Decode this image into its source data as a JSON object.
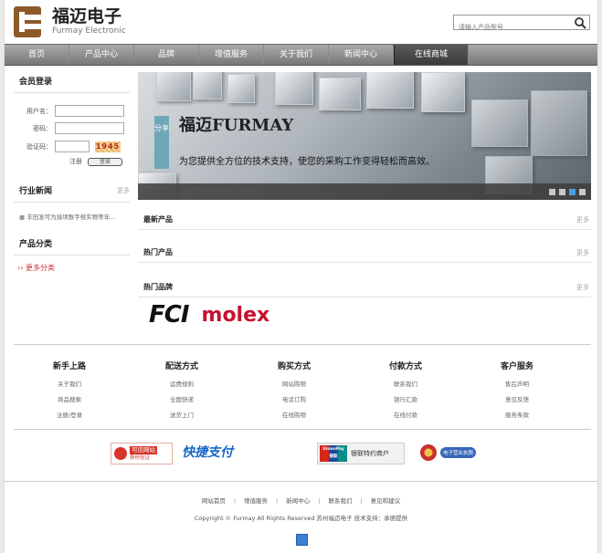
{
  "header": {
    "logo_cn": "福迈电子",
    "logo_en": "Furmay Electronic",
    "search_placeholder": "请输入产品型号"
  },
  "nav": [
    "首页",
    "产品中心",
    "品牌",
    "增值服务",
    "关于我们",
    "新闻中心",
    "在线商城"
  ],
  "sidebar": {
    "login_title": "会员登录",
    "username_label": "用户名：",
    "password_label": "密码：",
    "captcha_label": "验证码：",
    "captcha_code": "1945",
    "register_label": "注册",
    "login_button": "登录",
    "news_title": "行业新闻",
    "news_more": "更多",
    "news_item": "丰田发可为插项数字核实物等年...",
    "category_title": "产品分类",
    "category_more_link": "更多分类"
  },
  "banner": {
    "share": "分享",
    "title": "福迈FURMAY",
    "subtitle": "为您提供全方位的技术支持，使您的采购工作变得轻松而高效。"
  },
  "sections": [
    {
      "title": "最新产品",
      "more": "更多"
    },
    {
      "title": "热门产品",
      "more": "更多"
    },
    {
      "title": "热门品牌",
      "more": "更多"
    }
  ],
  "brands": [
    "FCI",
    "molex"
  ],
  "footer_columns": [
    {
      "title": "新手上路",
      "links": [
        "关于我们",
        "商品搜索",
        "注册/登录"
      ]
    },
    {
      "title": "配送方式",
      "links": [
        "运费规则",
        "全国快递",
        "送货上门"
      ]
    },
    {
      "title": "购买方式",
      "links": [
        "网站购物",
        "电话订购",
        "在线购物"
      ]
    },
    {
      "title": "付款方式",
      "links": [
        "联系我们",
        "银行汇款",
        "在线付款"
      ]
    },
    {
      "title": "客户服务",
      "links": [
        "售后声明",
        "意见反馈",
        "服务条款"
      ]
    }
  ],
  "payments": {
    "trust_line1": "可信网站",
    "trust_line2": "身份验证",
    "quickpay": "快捷支付",
    "unionpay_brand": "UnionPay",
    "unionpay_cn": "银联",
    "unionpay_text": "银联特约商户",
    "license": "电子营业执照"
  },
  "bottom_links": [
    "网站首页",
    "增值服务",
    "新闻中心",
    "联系我们",
    "意见和建议"
  ],
  "copyright": "Copyright © Furmay All Rights Reserved 苏州福迈电子 技术支持：承德提供"
}
